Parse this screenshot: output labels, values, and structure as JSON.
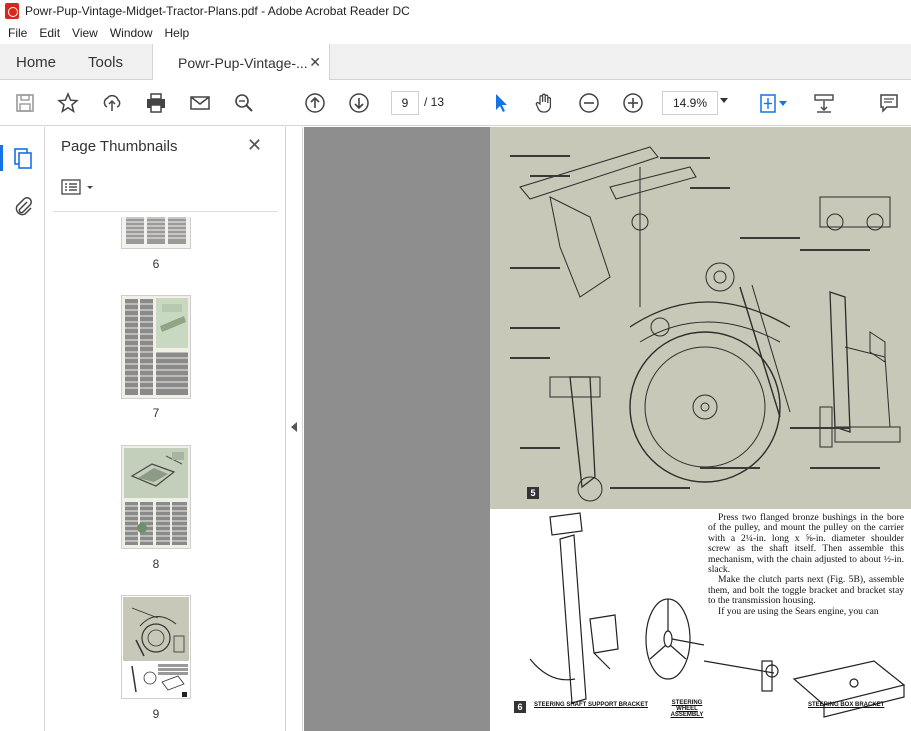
{
  "window": {
    "title": "Powr-Pup-Vintage-Midget-Tractor-Plans.pdf - Adobe Acrobat Reader DC"
  },
  "menu": [
    "File",
    "Edit",
    "View",
    "Window",
    "Help"
  ],
  "tabs": {
    "home": "Home",
    "tools": "Tools",
    "document": "Powr-Pup-Vintage-..."
  },
  "toolbar": {
    "current_page": "9",
    "total_pages": "/ 13",
    "zoom": "14.9%"
  },
  "panel": {
    "title": "Page Thumbnails"
  },
  "thumbnails": [
    {
      "label": "6"
    },
    {
      "label": "7"
    },
    {
      "label": "8"
    },
    {
      "label": "9"
    }
  ],
  "document_page": {
    "figure5_number": "5",
    "figure6_number": "6",
    "body_paragraphs": [
      "Press two flanged bronze bushings in the bore of the pulley, and mount the pulley on the carrier with a 2¼-in. long x ⅝-in. diameter shoulder screw as the shaft itself. Then assemble this mechanism, with the chain adjusted to about ½-in. slack.",
      "Make the clutch parts next (Fig. 5B), assemble them, and bolt the toggle bracket and bracket stay to the transmission housing.",
      "If you are using the Sears engine, you can"
    ],
    "captions": {
      "support_bracket": "STEERING SHAFT SUPPORT BRACKET",
      "steering_wheel": "STEERING WHEEL ASSEMBLY",
      "box_bracket": "STEERING BOX BRACKET"
    }
  }
}
